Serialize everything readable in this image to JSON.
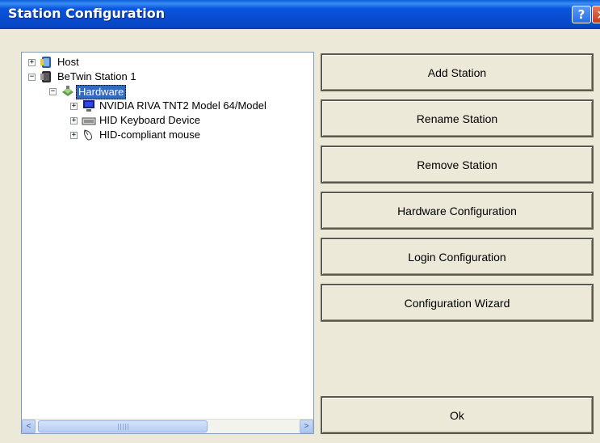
{
  "window": {
    "title": "Station Configuration",
    "help_glyph": "?",
    "close_glyph": "✕"
  },
  "tree": {
    "items": [
      {
        "label": "Host",
        "expander": "+",
        "icon": "host-computer-icon",
        "level": 0
      },
      {
        "label": "BeTwin Station 1",
        "expander": "−",
        "icon": "station-computer-icon",
        "level": 0
      },
      {
        "label": "Hardware",
        "expander": "−",
        "icon": "hardware-icon",
        "level": 1,
        "selected": true
      },
      {
        "label": "NVIDIA RIVA TNT2 Model 64/Model",
        "expander": "+",
        "icon": "monitor-icon",
        "level": 2
      },
      {
        "label": "HID Keyboard Device",
        "expander": "+",
        "icon": "keyboard-icon",
        "level": 2
      },
      {
        "label": "HID-compliant mouse",
        "expander": "+",
        "icon": "mouse-icon",
        "level": 2
      }
    ]
  },
  "scrollbar": {
    "left_arrow": "<",
    "right_arrow": ">",
    "position": 0.0
  },
  "buttons": {
    "add_station": "Add Station",
    "rename_station": "Rename Station",
    "remove_station": "Remove Station",
    "hardware_configuration": "Hardware Configuration",
    "login_configuration": "Login Configuration",
    "configuration_wizard": "Configuration Wizard",
    "ok": "Ok"
  },
  "colors": {
    "titlebar": "#0855dd",
    "selection": "#316ac5",
    "dialog_bg": "#ece9d8"
  }
}
